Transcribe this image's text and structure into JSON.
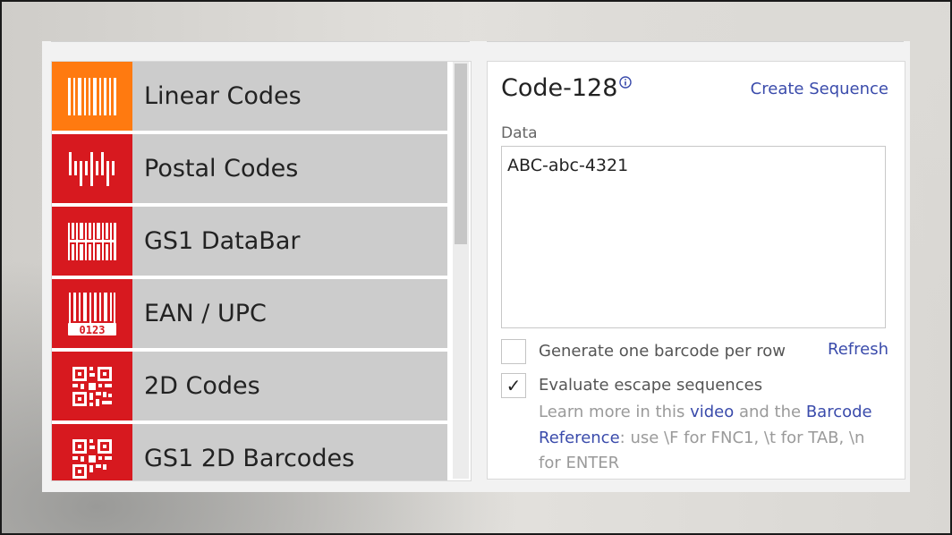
{
  "categories": [
    {
      "label": "Linear Codes",
      "icon": "linear-barcode-icon",
      "active": true
    },
    {
      "label": "Postal Codes",
      "icon": "postal-barcode-icon",
      "active": false
    },
    {
      "label": "GS1 DataBar",
      "icon": "databar-icon",
      "active": false
    },
    {
      "label": "EAN / UPC",
      "icon": "ean-upc-icon",
      "active": false
    },
    {
      "label": "2D Codes",
      "icon": "qr-code-icon",
      "active": false
    },
    {
      "label": "GS1 2D Barcodes",
      "icon": "gs1-qr-code-icon",
      "active": false
    }
  ],
  "ean_icon_digits": "0123",
  "settings": {
    "title": "Code-128",
    "create_sequence": "Create Sequence",
    "data_label": "Data",
    "data_value": "ABC-abc-4321",
    "one_per_row_label": "Generate one barcode per row",
    "one_per_row_checked": false,
    "refresh": "Refresh",
    "escape_label": "Evaluate escape sequences",
    "escape_checked": true,
    "check_glyph": "✓",
    "help_1": "Learn more in this ",
    "help_link_video": "video",
    "help_2": " and the ",
    "help_link_reference": "Barcode Reference",
    "help_3": ": use \\F for FNC1, \\t for TAB, \\n for ENTER"
  },
  "colors": {
    "active_icon_bg": "#ff7a10",
    "icon_bg": "#d7191f",
    "link": "#3a4bab"
  }
}
